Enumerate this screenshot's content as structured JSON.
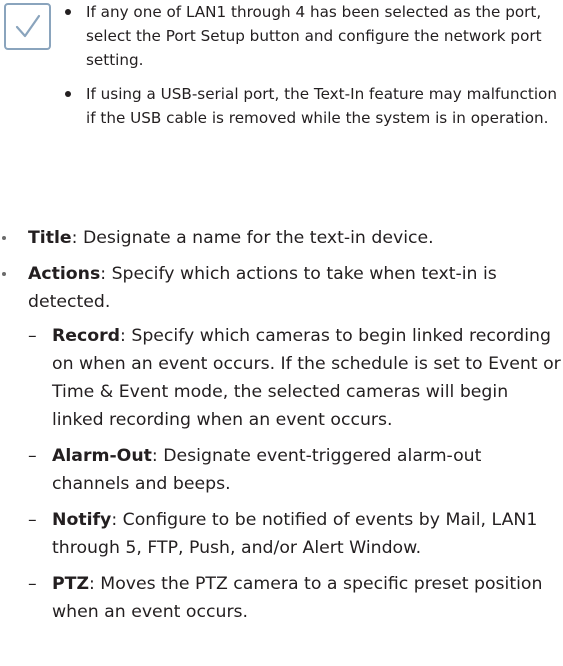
{
  "note": {
    "icon": "check-icon",
    "icon_color": "#8aa4bd",
    "items": [
      "If any one of LAN1 through 4 has been selected as the port, select the Port Setup button and configure the network port setting.",
      "If using a USB-serial port, the Text-In feature may malfunction if the USB cable is removed while the system is in operation."
    ]
  },
  "items": [
    {
      "term": "Title",
      "desc": ": Designate a name for the text-in device."
    },
    {
      "term": "Actions",
      "desc": ": Specify which actions to take when text-in is detected.",
      "subitems": [
        {
          "term": "Record",
          "desc": ": Specify which cameras to begin linked recording on when an event occurs. If the schedule is set to Event or Time & Event mode, the selected cameras will begin linked recording when an event occurs."
        },
        {
          "term": "Alarm-Out",
          "desc": ": Designate event-triggered alarm-out channels and beeps."
        },
        {
          "term": "Notify",
          "desc": ": Configure to be notified of events by Mail, LAN1 through 5, FTP, Push, and/or Alert Window."
        },
        {
          "term": "PTZ",
          "desc": ": Moves the PTZ camera to a specific preset position when an event occurs."
        }
      ]
    }
  ]
}
